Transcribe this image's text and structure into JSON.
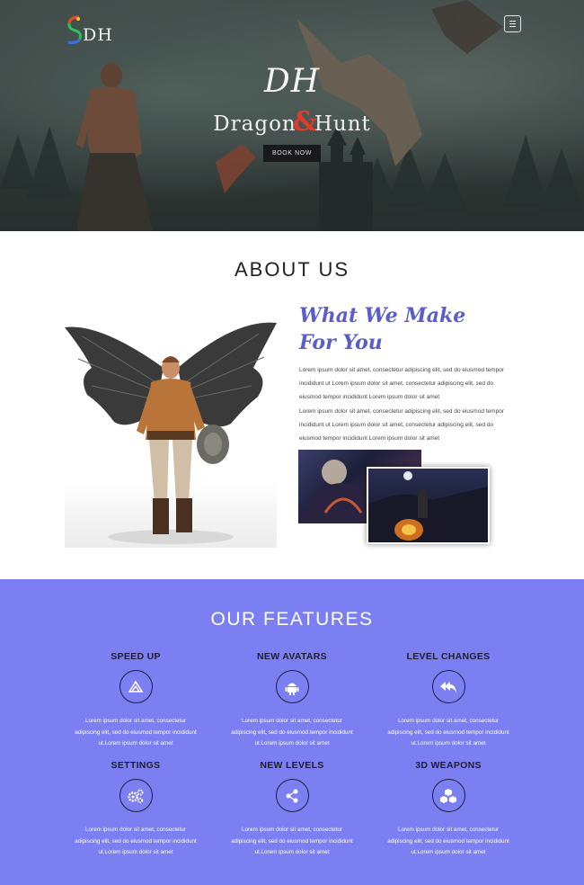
{
  "header": {
    "logo_text": "DH",
    "menu_icon": "hamburger-icon"
  },
  "hero": {
    "mark": "DH",
    "title_left": "Dragon",
    "title_amp": "&",
    "title_right": "Hunt",
    "button_label": "BOOK NOW"
  },
  "about": {
    "heading": "ABOUT US",
    "subheading_line1": "What We Make",
    "subheading_line2": "For You",
    "paragraph1": "Lorem ipsum dolor sit amet, consectetur adipiscing elit, sed do eiusmod tempor incididunt ut Lorem ipsum dolor sit amet, consectetur adipiscing elit, sed do eiusmod tempor incididunt Lorem ipsum dolor sit amet",
    "paragraph2": "Lorem ipsum dolor sit amet, consectetur adipiscing elit, sed do eiusmod tempor incididunt ut Lorem ipsum dolor sit amet, consectetur adipiscing elit, sed do eiusmod tempor incididunt Lorem ipsum dolor sit amet"
  },
  "features": {
    "heading": "OUR FEATURES",
    "items": [
      {
        "title": "SPEED UP",
        "icon": "speed-icon",
        "text": "Lorem ipsum dolor sit amet, consectetur adipiscing elit, sed do eiusmod tempor incididunt ut.Lorem ipsum dolor sit amet"
      },
      {
        "title": "NEW AVATARS",
        "icon": "android-icon",
        "text": "Lorem ipsum dolor sit amet, consectetur adipiscing elit, sed do eiusmod tempor incididunt ut.Lorem ipsum dolor sit amet"
      },
      {
        "title": "LEVEL CHANGES",
        "icon": "reply-all-icon",
        "text": "Lorem ipsum dolor sit amet, consectetur adipiscing elit, sed do eiusmod tempor incididunt ut.Lorem ipsum dolor sit amet"
      },
      {
        "title": "SETTINGS",
        "icon": "cogs-icon",
        "text": "Lorem ipsum dolor sit amet, consectetur adipiscing elit, sed do eiusmod tempor incididunt ut.Lorem ipsum dolor sit amet"
      },
      {
        "title": "NEW LEVELS",
        "icon": "share-icon",
        "text": "Lorem ipsum dolor sit amet, consectetur adipiscing elit, sed do eiusmod tempor incididunt ut.Lorem ipsum dolor sit amet"
      },
      {
        "title": "3D WEAPONS",
        "icon": "cubes-icon",
        "text": "Lorem ipsum dolor sit amet, consectetur adipiscing elit, sed do eiusmod tempor incididunt ut.Lorem ipsum dolor sit amet"
      }
    ]
  },
  "colors": {
    "features_bg": "#7b7ff2",
    "accent_title": "#5a5ec9",
    "hero_amp": "#e23b2a"
  }
}
